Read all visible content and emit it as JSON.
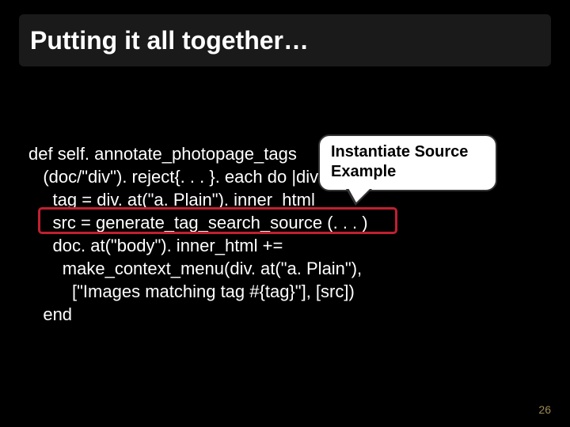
{
  "slide": {
    "title": "Putting it all together…",
    "page_number": "26"
  },
  "callout": {
    "line1": "Instantiate Source",
    "line2": "Example"
  },
  "code": {
    "l1": "def self. annotate_photopage_tags",
    "l2": "   (doc/\"div\"). reject{. . . }. each do |div|",
    "l3": "     tag = div. at(\"a. Plain\"). inner_html",
    "l4": "     src = generate_tag_search_source (. . . )",
    "l5": "     doc. at(\"body\"). inner_html +=",
    "l6": "       make_context_menu(div. at(\"a. Plain\"),",
    "l7": "         [\"Images matching tag #{tag}\"], [src])",
    "l8": "   end"
  }
}
